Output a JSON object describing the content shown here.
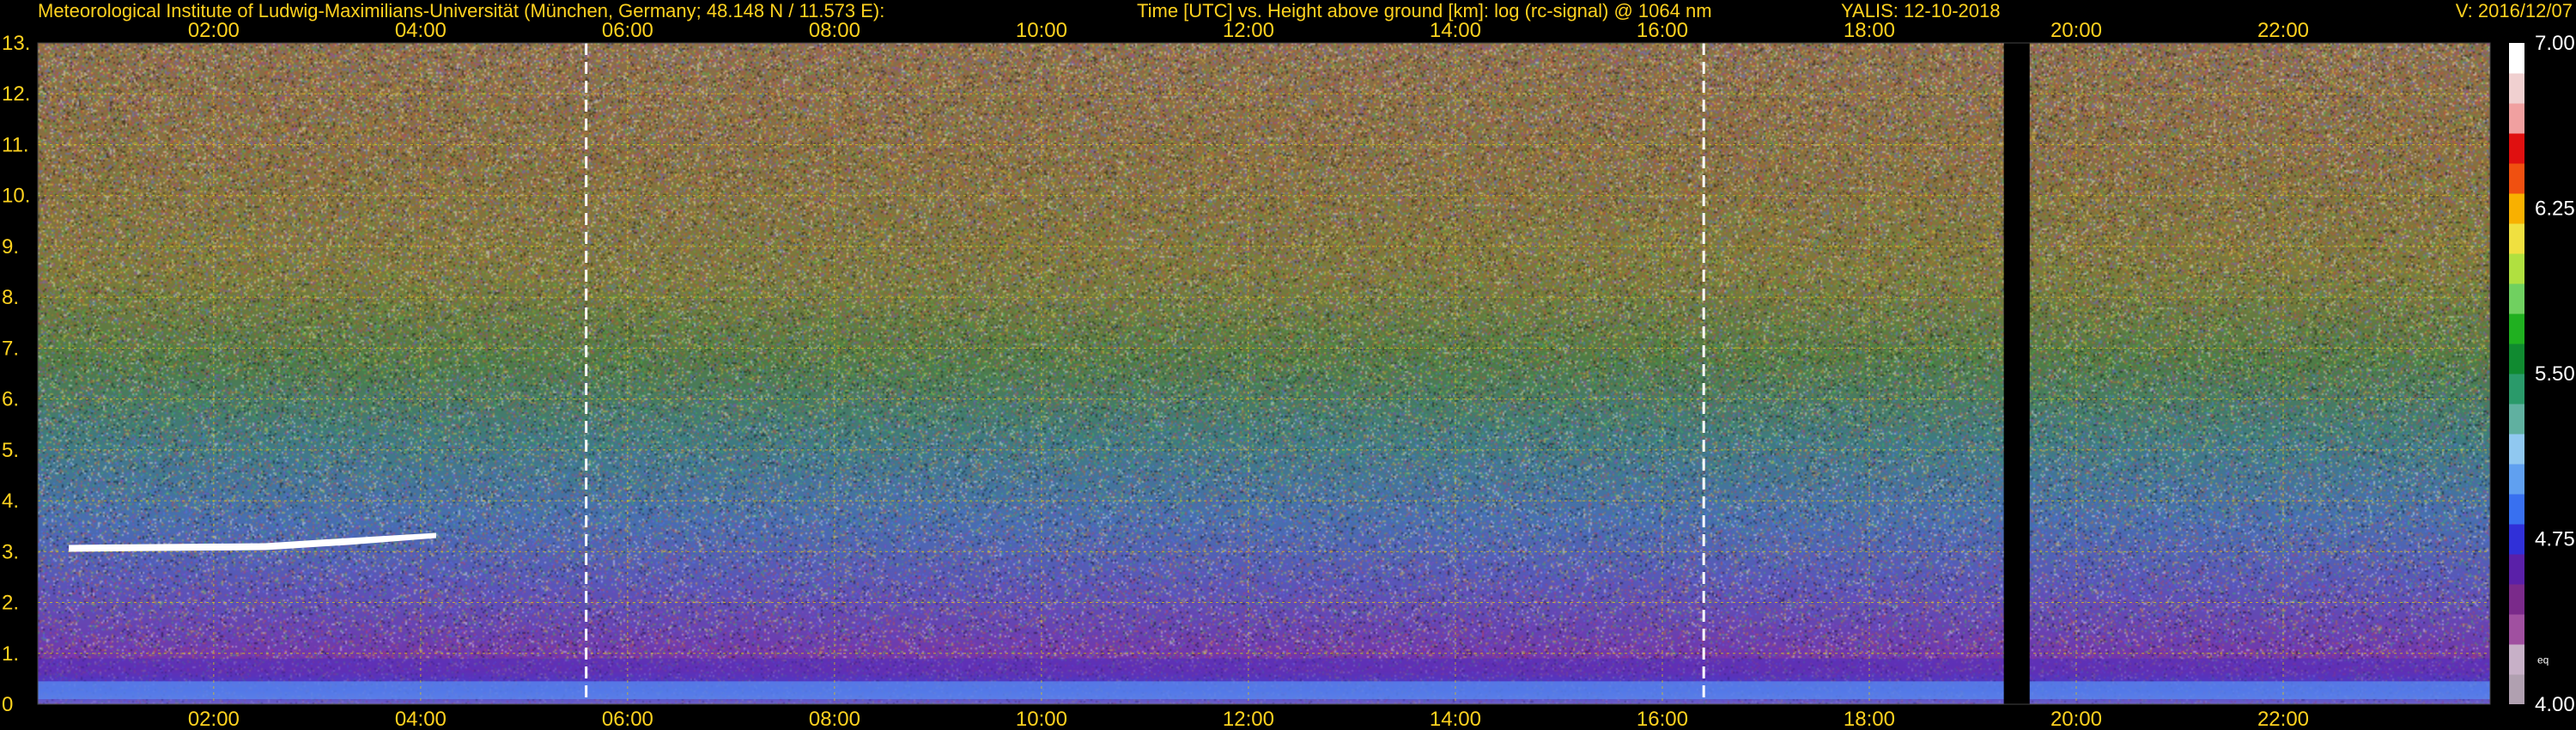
{
  "header": {
    "institute": "Meteorological Institute of Ludwig-Maximilians-Universität (München, Germany; 48.148 N / 11.573 E):",
    "title": "Time [UTC] vs. Height above ground [km]: log (rc-signal) @ 1064 nm",
    "instrument": "YALIS: 12-10-2018",
    "version": "V: 2016/12/07"
  },
  "colors": {
    "text": "#ffd21f",
    "grid": "#d8c31a",
    "background": "#000000"
  },
  "chart_data": {
    "type": "heatmap",
    "title": "Time [UTC] vs. Height above ground [km]: log (rc-signal) @ 1064 nm",
    "xlabel": "",
    "ylabel": "",
    "x_ticks": [
      "02:00",
      "04:00",
      "06:00",
      "08:00",
      "10:00",
      "12:00",
      "14:00",
      "16:00",
      "18:00",
      "20:00",
      "22:00"
    ],
    "x_tick_hours": [
      2,
      4,
      6,
      8,
      10,
      12,
      14,
      16,
      18,
      20,
      22
    ],
    "xlim_hours": [
      0.3,
      24
    ],
    "y_ticks": [
      "0",
      "1.",
      "2.",
      "3.",
      "4.",
      "5.",
      "6.",
      "7.",
      "8.",
      "9.",
      "10.",
      "11.",
      "12.",
      "13."
    ],
    "y_tick_values": [
      0,
      1,
      2,
      3,
      4,
      5,
      6,
      7,
      8,
      9,
      10,
      11,
      12,
      13
    ],
    "ylim_km": [
      0,
      13
    ],
    "grid": true,
    "dashed_markers_hours": [
      5.6,
      16.4
    ],
    "data_gap_hours": [
      19.3,
      19.55
    ],
    "cloud_layer": {
      "time_start_hours": 0.6,
      "time_end_hours": 4.15,
      "height_km": 3.2
    },
    "colorbar": {
      "tick_labels": [
        "7.00",
        "6.25",
        "5.50",
        "4.75",
        "4.00"
      ],
      "tick_values": [
        7.0,
        6.25,
        5.5,
        4.75,
        4.0
      ],
      "range": [
        4.0,
        7.0
      ],
      "unit_label": "eq",
      "colors": [
        "#b0a0b0",
        "#c7b0c7",
        "#a050a0",
        "#7a2a8a",
        "#5a20a8",
        "#3030d8",
        "#3870f0",
        "#60a0f0",
        "#90c8f0",
        "#60b0a0",
        "#2a9a6a",
        "#108a30",
        "#20b020",
        "#70d060",
        "#b0e040",
        "#f0e040",
        "#f8b000",
        "#f05010",
        "#e01010",
        "#f0a0a0",
        "#f0d0d0",
        "#ffffff"
      ]
    }
  }
}
